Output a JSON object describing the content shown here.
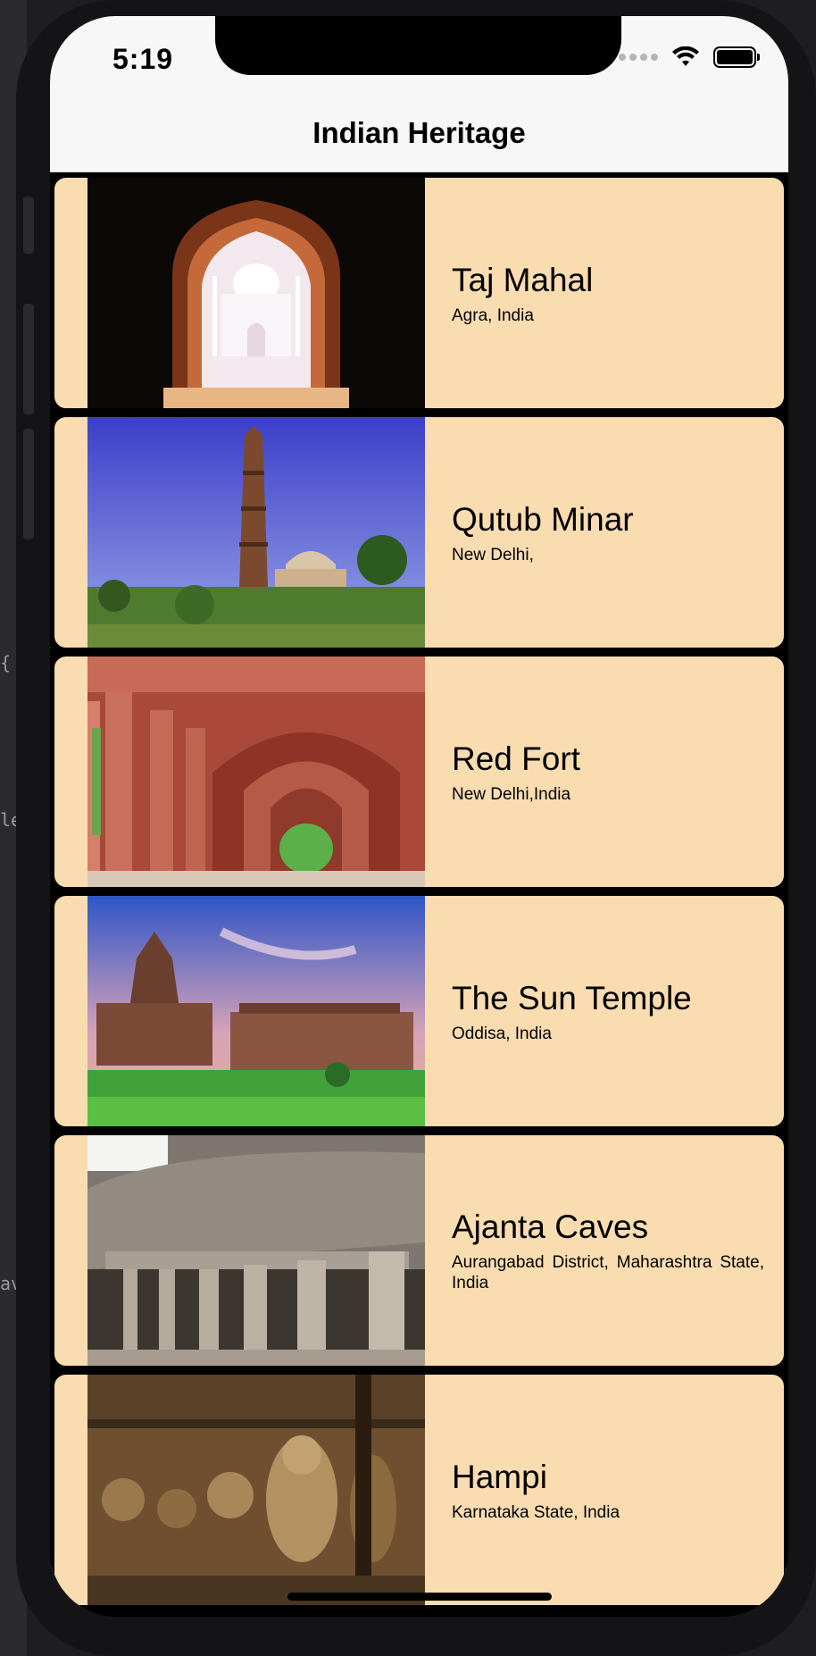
{
  "status_bar": {
    "time": "5:19"
  },
  "navigation": {
    "title": "Indian Heritage"
  },
  "places": [
    {
      "name": "Taj Mahal",
      "location": "Agra, India",
      "image_icon": "taj-mahal-photo"
    },
    {
      "name": "Qutub Minar",
      "location": "New Delhi,",
      "image_icon": "qutub-minar-photo"
    },
    {
      "name": "Red Fort",
      "location": "New Delhi,India",
      "image_icon": "red-fort-photo"
    },
    {
      "name": "The Sun Temple",
      "location": "Oddisa, India",
      "image_icon": "sun-temple-photo"
    },
    {
      "name": "Ajanta Caves",
      "location": "Aurangabad District, Maharashtra State, India",
      "image_icon": "ajanta-caves-photo"
    },
    {
      "name": "Hampi",
      "location": "Karnataka State, India",
      "image_icon": "hampi-photo"
    }
  ],
  "colors": {
    "card_background": "#fadcb1",
    "card_border": "#000000",
    "nav_background": "#f7f7f7"
  },
  "editor_fragments": [
    "{",
    "le",
    "av"
  ]
}
